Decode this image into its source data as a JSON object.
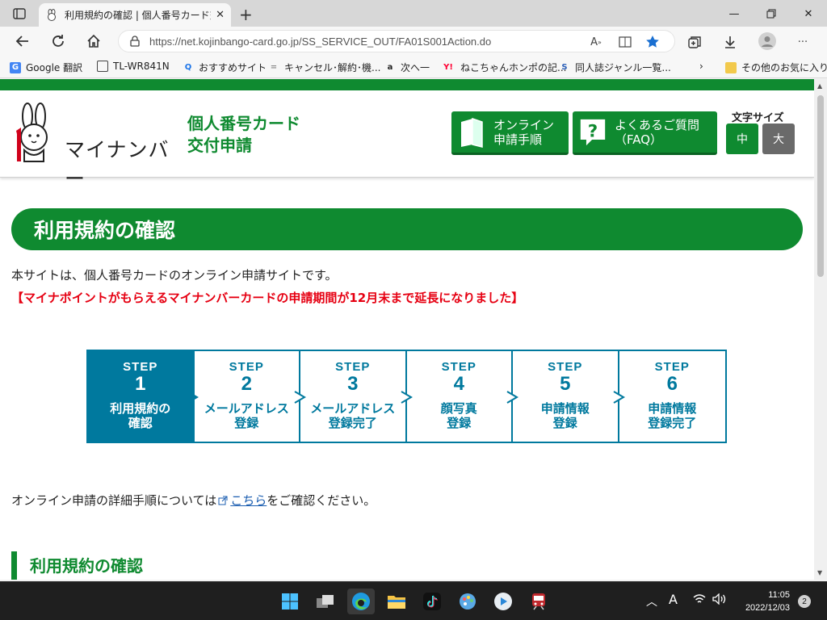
{
  "browser": {
    "tab_title": "利用規約の確認 | 個人番号カード交付申請",
    "url": "https://net.kojinbango-card.go.jp/SS_SERVICE_OUT/FA01S001Action.do",
    "bookmarks": [
      {
        "label": "Google 翻訳",
        "icon": "G",
        "color": "#4285f4"
      },
      {
        "label": "TL-WR841N",
        "icon": "page",
        "color": "#444444"
      },
      {
        "label": "おすすめサイト",
        "icon": "Q",
        "color": "#1a73e8"
      },
      {
        "label": "キャンセル･解約･機...",
        "icon": "=",
        "color": "#888888"
      },
      {
        "label": "次へ一",
        "icon": "a",
        "color": "#222222"
      },
      {
        "label": "ねこちゃんホンポの記...",
        "icon": "Y!",
        "color": "#ff0033"
      },
      {
        "label": "同人誌ジャンル一覧...",
        "icon": "S",
        "color": "#2b5fb8"
      }
    ],
    "other_bookmarks": "その他のお気に入り"
  },
  "header": {
    "logo_text": "マイナンバー",
    "service_line1": "個人番号カード",
    "service_line2": "交付申請",
    "online_btn_line1": "オンライン",
    "online_btn_line2": "申請手順",
    "faq_btn_line1": "よくあるご質問",
    "faq_btn_line2": "（FAQ）",
    "font_size_label": "文字サイズ",
    "font_mid": "中",
    "font_large": "大"
  },
  "main": {
    "banner_title": "利用規約の確認",
    "intro": "本サイトは、個人番号カードのオンライン申請サイトです。",
    "notice": "【マイナポイントがもらえるマイナンバーカードの申請期間が12月末まで延長になりました】",
    "steps": [
      {
        "label": "STEP",
        "num": "1",
        "text": "利用規約の\n確認"
      },
      {
        "label": "STEP",
        "num": "2",
        "text": "メールアドレス\n登録"
      },
      {
        "label": "STEP",
        "num": "3",
        "text": "メールアドレス\n登録完了"
      },
      {
        "label": "STEP",
        "num": "4",
        "text": "顔写真\n登録"
      },
      {
        "label": "STEP",
        "num": "5",
        "text": "申請情報\n登録"
      },
      {
        "label": "STEP",
        "num": "6",
        "text": "申請情報\n登録完了"
      }
    ],
    "detail_prefix": "オンライン申請の詳細手順については",
    "detail_link": "こちら",
    "detail_suffix": "をご確認ください。",
    "section_heading": "利用規約の確認"
  },
  "taskbar": {
    "ime": "A",
    "time": "11:05",
    "date": "2022/12/03",
    "notifications": "2"
  },
  "colors": {
    "brand_green": "#0f8a30",
    "step_blue": "#00799e",
    "notice_red": "#e60012"
  }
}
